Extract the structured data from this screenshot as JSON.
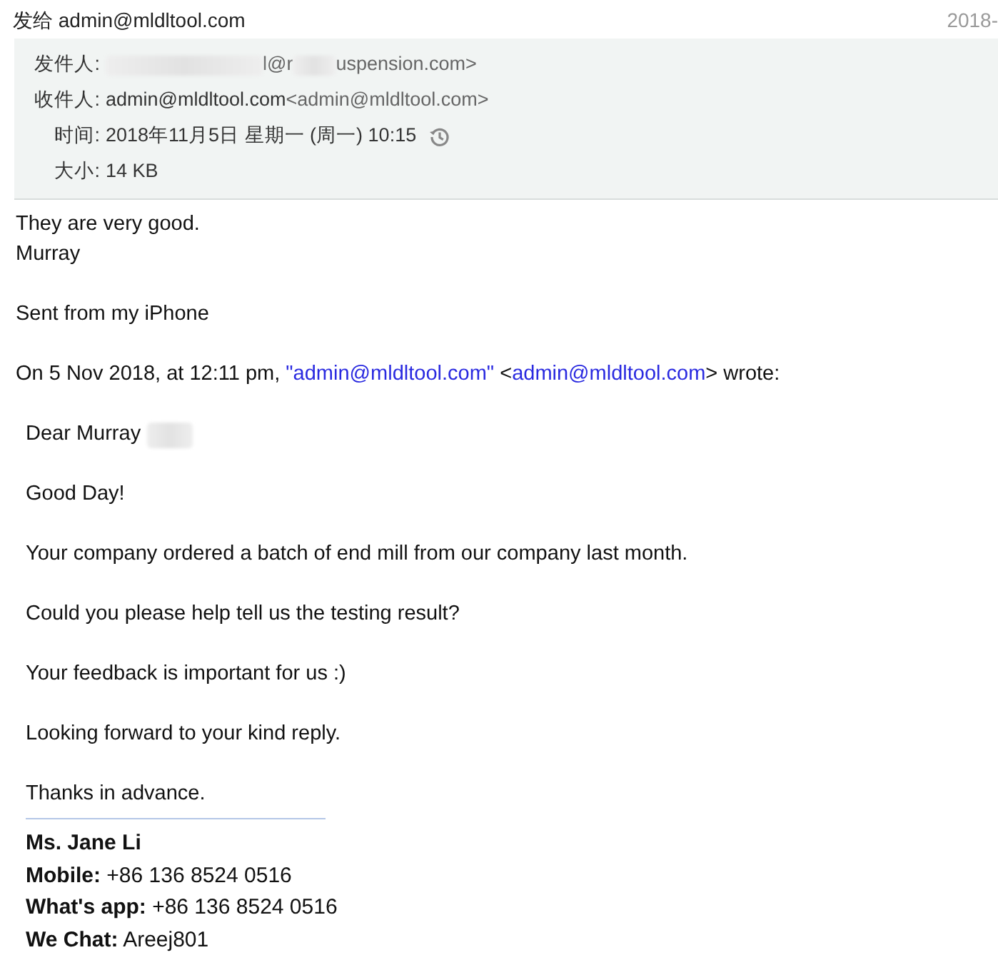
{
  "header": {
    "to_label": "发给",
    "to_address": "admin@mldltool.com",
    "date": "2018-"
  },
  "details": {
    "sender": {
      "label": "发件人:",
      "parts": [
        "l@r",
        "uspension.com>"
      ]
    },
    "recipient": {
      "label": "收件人:",
      "name": "admin@mldltool.com",
      "address": "<admin@mldltool.com>"
    },
    "time": {
      "label": "时间:",
      "value": "2018年11月5日 星期一 (周一) 10:15"
    },
    "size": {
      "label": "大小:",
      "value": "14 KB"
    }
  },
  "reply": [
    [
      "They are very good.",
      "Murray"
    ],
    [
      "Sent from my iPhone"
    ]
  ],
  "attribution": {
    "prefix": "On 5 Nov 2018, at 12:11 pm, ",
    "name_link": "\"admin@mldltool.com\"",
    "middle": " <",
    "address_link": "admin@mldltool.com",
    "suffix": "> wrote:"
  },
  "quoted": {
    "greeting": "Dear Murray",
    "paragraphs": [
      "Good Day!",
      "Your company ordered a batch of end mill from our company last month.",
      "Could you please help tell us the testing result?",
      "Your feedback is important for us :)",
      "Looking forward to your kind reply.",
      "Thanks in advance."
    ],
    "signature": {
      "name": "Ms. Jane Li",
      "fields": [
        {
          "label": "Mobile:",
          "value": "+86 136 8524 0516"
        },
        {
          "label": "What's app:",
          "value": "+86 136 8524 0516"
        },
        {
          "label": "We Chat:",
          "value": "Areej801"
        }
      ]
    }
  }
}
